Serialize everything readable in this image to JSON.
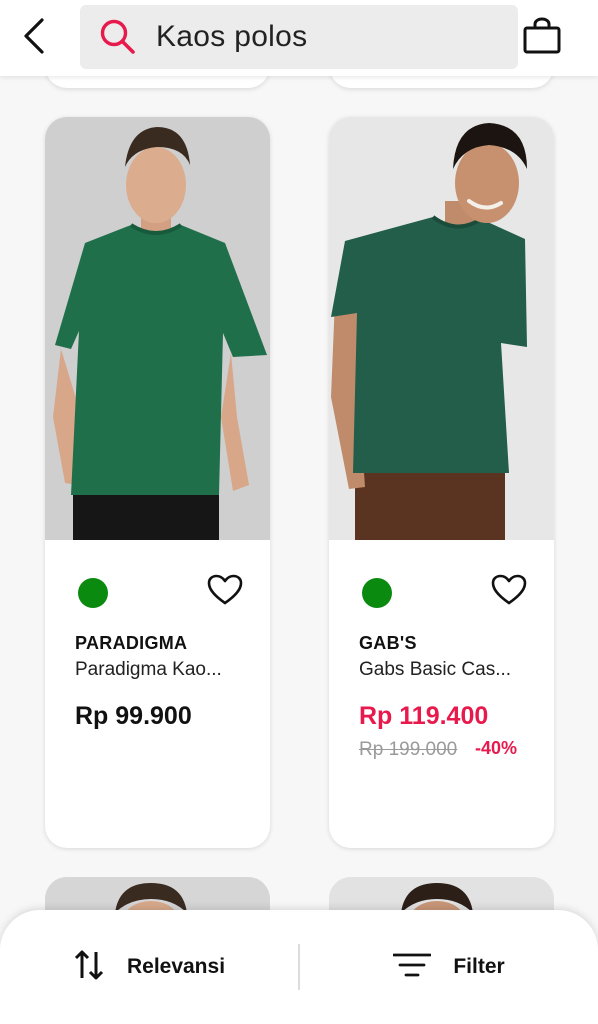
{
  "header": {
    "search_query": "Kaos polos"
  },
  "products": [
    {
      "brand": "PARADIGMA",
      "name": "Paradigma Kao...",
      "price": "Rp 99.900",
      "swatch_color": "#0b8a10",
      "shirt_color": "#1f6f4b"
    },
    {
      "brand": "GAB'S",
      "name": "Gabs Basic Cas...",
      "price": "Rp 119.400",
      "old_price": "Rp 199.000",
      "discount": "-40%",
      "swatch_color": "#0b8a10",
      "shirt_color": "#235e4a"
    }
  ],
  "bottom_bar": {
    "sort_label": "Relevansi",
    "filter_label": "Filter"
  },
  "colors": {
    "accent": "#e8194d",
    "swatch_green": "#0b8a10"
  },
  "icons": {
    "back": "chevron-left-icon",
    "search": "search-icon",
    "bag": "shopping-bag-icon",
    "wishlist": "heart-outline-icon",
    "sort": "sort-arrows-icon",
    "filter": "filter-lines-icon"
  }
}
